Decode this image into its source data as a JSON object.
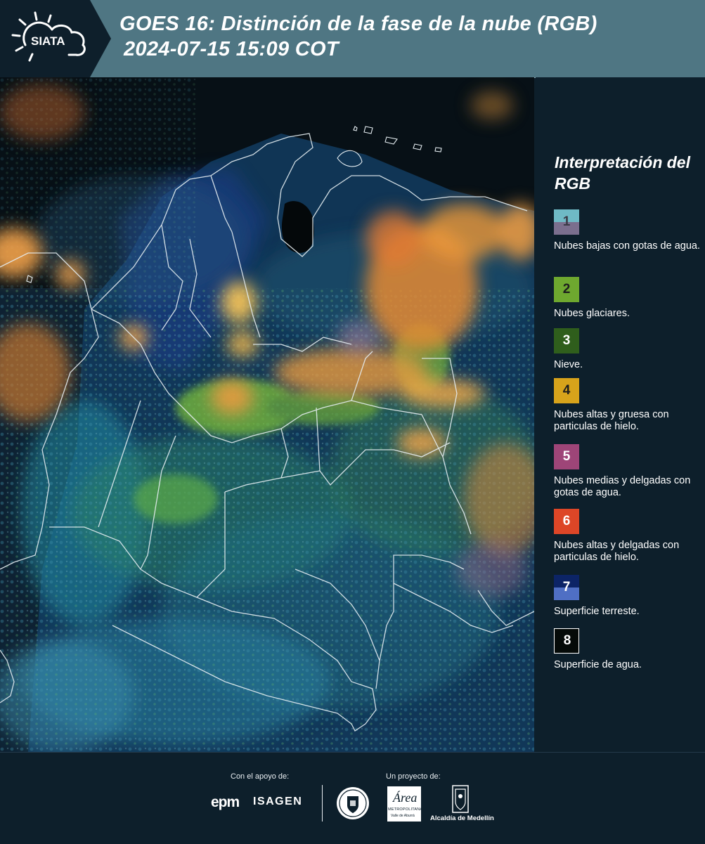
{
  "header": {
    "logo_text": "SIATA",
    "title_line1": "GOES 16: Distinción de la fase de la nube (RGB)",
    "title_line2": "2024-07-15 15:09 COT"
  },
  "legend": {
    "title": "Interpretación del RGB",
    "items": [
      {
        "number": "1",
        "label": "Nubes bajas con gotas de agua.",
        "colors": [
          "#6fbac6",
          "#7b6f8e"
        ]
      },
      {
        "number": "2",
        "label": "Nubes glaciares.",
        "colors": [
          "#6ea82f"
        ]
      },
      {
        "number": "3",
        "label": "Nieve.",
        "colors": [
          "#2f5e1c"
        ]
      },
      {
        "number": "4",
        "label": "Nubes altas y gruesa con particulas de hielo.",
        "colors": [
          "#d7a31b"
        ]
      },
      {
        "number": "5",
        "label": "Nubes medias y delgadas con gotas de agua.",
        "colors": [
          "#9e4578"
        ]
      },
      {
        "number": "6",
        "label": "Nubes altas y delgadas con particulas de hielo.",
        "colors": [
          "#dd4627"
        ]
      },
      {
        "number": "7",
        "label": "Superficie terreste.",
        "colors": [
          "#0c2466",
          "#4f6fc4"
        ]
      },
      {
        "number": "8",
        "label": "Superficie de agua.",
        "colors": [
          "#050a08"
        ]
      }
    ]
  },
  "map": {
    "description_icon": "satellite-rgb-image"
  },
  "footer": {
    "support_label": "Con el apoyo de:",
    "project_label": "Un proyecto de:",
    "epm": "epm",
    "isagen": "ISAGEN",
    "area_logo_text": "Área",
    "area_logo_sub": "METROPOLITANA",
    "area_logo_sub2": "Valle de Aburrá",
    "alcaldia": "Alcaldía de Medellín"
  }
}
